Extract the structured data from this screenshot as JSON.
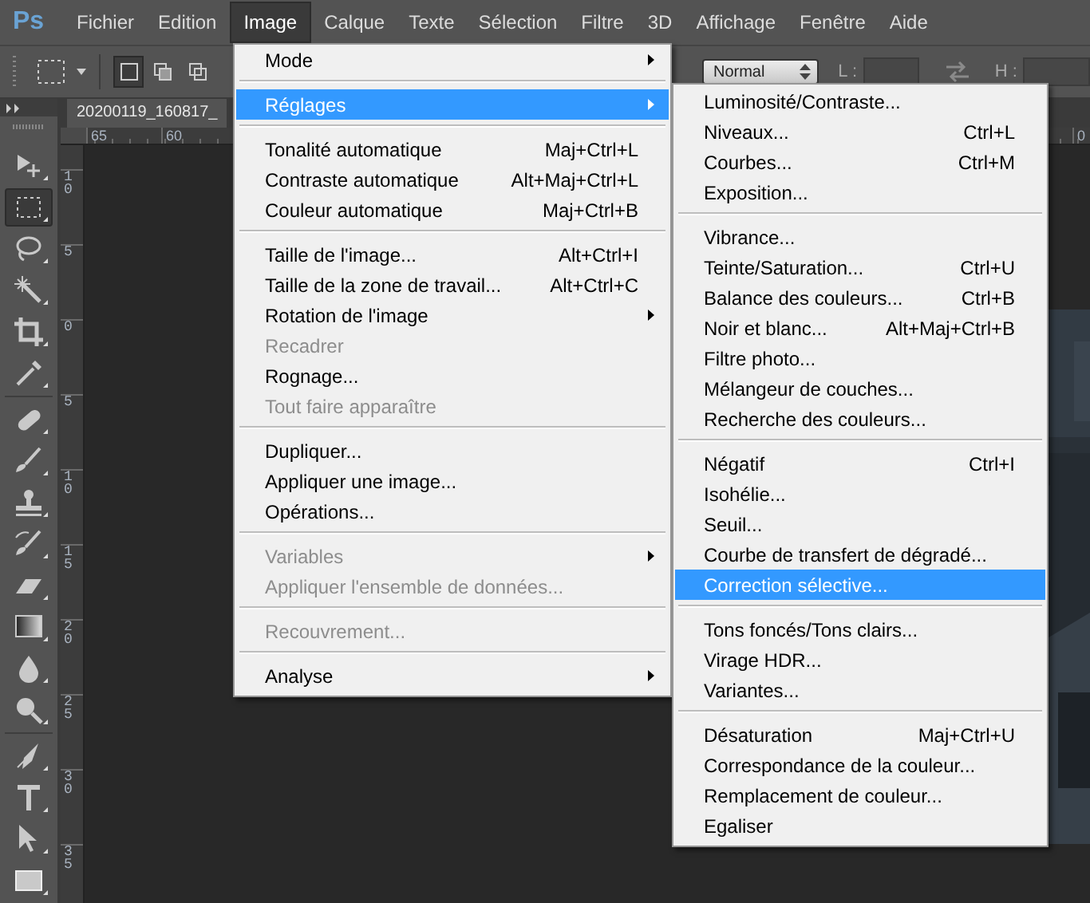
{
  "app_logo": "Ps",
  "menu_bar": [
    {
      "label": "Fichier",
      "selected": false
    },
    {
      "label": "Edition",
      "selected": false
    },
    {
      "label": "Image",
      "selected": true
    },
    {
      "label": "Calque",
      "selected": false
    },
    {
      "label": "Texte",
      "selected": false
    },
    {
      "label": "Sélection",
      "selected": false
    },
    {
      "label": "Filtre",
      "selected": false
    },
    {
      "label": "3D",
      "selected": false
    },
    {
      "label": "Affichage",
      "selected": false
    },
    {
      "label": "Fenêtre",
      "selected": false
    },
    {
      "label": "Aide",
      "selected": false
    }
  ],
  "options_bar": {
    "selection_modes": [
      {
        "selected": true
      },
      {
        "selected": false
      },
      {
        "selected": false
      }
    ],
    "style": "Normal",
    "width_label": "L :",
    "height_label": "H :"
  },
  "tool_groups": [
    [
      {
        "kind": "move",
        "selected": false
      },
      {
        "kind": "marquee",
        "selected": true
      },
      {
        "kind": "lasso",
        "selected": false
      },
      {
        "kind": "wand",
        "selected": false
      },
      {
        "kind": "crop",
        "selected": false
      },
      {
        "kind": "eyedropper",
        "selected": false
      }
    ],
    [
      {
        "kind": "healing",
        "selected": false
      },
      {
        "kind": "brush",
        "selected": false
      },
      {
        "kind": "stamp",
        "selected": false
      },
      {
        "kind": "history",
        "selected": false
      },
      {
        "kind": "eraser",
        "selected": false
      },
      {
        "kind": "gradient",
        "selected": false
      },
      {
        "kind": "blur",
        "selected": false
      },
      {
        "kind": "dodge",
        "selected": false
      }
    ],
    [
      {
        "kind": "pen",
        "selected": false
      },
      {
        "kind": "type",
        "selected": false
      },
      {
        "kind": "path",
        "selected": false
      },
      {
        "kind": "shape",
        "selected": false
      }
    ]
  ],
  "document_tab": {
    "title": "20200119_160817_"
  },
  "rulers": {
    "horizontal": [
      "65",
      "60"
    ],
    "horizontal_end": "0",
    "vertical": [
      "10",
      "5",
      "0",
      "5",
      "10",
      "15",
      "20",
      "25",
      "30",
      "35"
    ]
  },
  "image_menu": {
    "groups": [
      [
        {
          "label": "Mode",
          "kind": "submenu",
          "disabled": false,
          "selected": false
        }
      ],
      [
        {
          "label": "Réglages",
          "kind": "submenu",
          "disabled": false,
          "selected": true
        }
      ],
      [
        {
          "label": "Tonalité automatique",
          "shortcut": "Maj+Ctrl+L",
          "kind": "item",
          "disabled": false,
          "selected": false
        },
        {
          "label": "Contraste automatique",
          "shortcut": "Alt+Maj+Ctrl+L",
          "kind": "item",
          "disabled": false,
          "selected": false
        },
        {
          "label": "Couleur automatique",
          "shortcut": "Maj+Ctrl+B",
          "kind": "item",
          "disabled": false,
          "selected": false
        }
      ],
      [
        {
          "label": "Taille de l'image...",
          "shortcut": "Alt+Ctrl+I",
          "kind": "item",
          "disabled": false,
          "selected": false
        },
        {
          "label": "Taille de la zone de travail...",
          "shortcut": "Alt+Ctrl+C",
          "kind": "item",
          "disabled": false,
          "selected": false
        },
        {
          "label": "Rotation de l'image",
          "kind": "submenu",
          "disabled": false,
          "selected": false
        },
        {
          "label": "Recadrer",
          "kind": "item",
          "disabled": true,
          "selected": false
        },
        {
          "label": "Rognage...",
          "kind": "item",
          "disabled": false,
          "selected": false
        },
        {
          "label": "Tout faire apparaître",
          "kind": "item",
          "disabled": true,
          "selected": false
        }
      ],
      [
        {
          "label": "Dupliquer...",
          "kind": "item",
          "disabled": false,
          "selected": false
        },
        {
          "label": "Appliquer une image...",
          "kind": "item",
          "disabled": false,
          "selected": false
        },
        {
          "label": "Opérations...",
          "kind": "item",
          "disabled": false,
          "selected": false
        }
      ],
      [
        {
          "label": "Variables",
          "kind": "submenu",
          "disabled": true,
          "selected": false
        },
        {
          "label": "Appliquer l'ensemble de données...",
          "kind": "item",
          "disabled": true,
          "selected": false
        }
      ],
      [
        {
          "label": "Recouvrement...",
          "kind": "item",
          "disabled": true,
          "selected": false
        }
      ],
      [
        {
          "label": "Analyse",
          "kind": "submenu",
          "disabled": false,
          "selected": false
        }
      ]
    ]
  },
  "adjustments_submenu": {
    "groups": [
      [
        {
          "label": "Luminosité/Contraste...",
          "kind": "item",
          "disabled": false,
          "selected": false
        },
        {
          "label": "Niveaux...",
          "shortcut": "Ctrl+L",
          "kind": "item",
          "disabled": false,
          "selected": false
        },
        {
          "label": "Courbes...",
          "shortcut": "Ctrl+M",
          "kind": "item",
          "disabled": false,
          "selected": false
        },
        {
          "label": "Exposition...",
          "kind": "item",
          "disabled": false,
          "selected": false
        }
      ],
      [
        {
          "label": "Vibrance...",
          "kind": "item",
          "disabled": false,
          "selected": false
        },
        {
          "label": "Teinte/Saturation...",
          "shortcut": "Ctrl+U",
          "kind": "item",
          "disabled": false,
          "selected": false
        },
        {
          "label": "Balance des couleurs...",
          "shortcut": "Ctrl+B",
          "kind": "item",
          "disabled": false,
          "selected": false
        },
        {
          "label": "Noir et blanc...",
          "shortcut": "Alt+Maj+Ctrl+B",
          "kind": "item",
          "disabled": false,
          "selected": false
        },
        {
          "label": "Filtre photo...",
          "kind": "item",
          "disabled": false,
          "selected": false
        },
        {
          "label": "Mélangeur de couches...",
          "kind": "item",
          "disabled": false,
          "selected": false
        },
        {
          "label": "Recherche des couleurs...",
          "kind": "item",
          "disabled": false,
          "selected": false
        }
      ],
      [
        {
          "label": "Négatif",
          "shortcut": "Ctrl+I",
          "kind": "item",
          "disabled": false,
          "selected": false
        },
        {
          "label": "Isohélie...",
          "kind": "item",
          "disabled": false,
          "selected": false
        },
        {
          "label": "Seuil...",
          "kind": "item",
          "disabled": false,
          "selected": false
        },
        {
          "label": "Courbe de transfert de dégradé...",
          "kind": "item",
          "disabled": false,
          "selected": false
        },
        {
          "label": "Correction sélective...",
          "kind": "item",
          "disabled": false,
          "selected": true
        }
      ],
      [
        {
          "label": "Tons foncés/Tons clairs...",
          "kind": "item",
          "disabled": false,
          "selected": false
        },
        {
          "label": "Virage HDR...",
          "kind": "item",
          "disabled": false,
          "selected": false
        },
        {
          "label": "Variantes...",
          "kind": "item",
          "disabled": false,
          "selected": false
        }
      ],
      [
        {
          "label": "Désaturation",
          "shortcut": "Maj+Ctrl+U",
          "kind": "item",
          "disabled": false,
          "selected": false
        },
        {
          "label": "Correspondance de la couleur...",
          "kind": "item",
          "disabled": false,
          "selected": false
        },
        {
          "label": "Remplacement de couleur...",
          "kind": "item",
          "disabled": false,
          "selected": false
        },
        {
          "label": "Egaliser",
          "kind": "item",
          "disabled": false,
          "selected": false
        }
      ]
    ]
  }
}
